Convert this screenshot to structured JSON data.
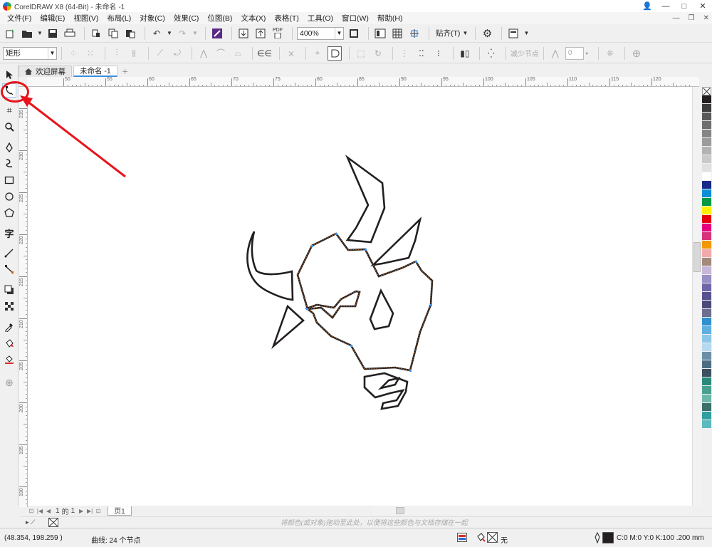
{
  "window": {
    "title": "CorelDRAW X8 (64-Bit) - 未命名 -1",
    "controls": [
      "minimize",
      "maximize",
      "close"
    ]
  },
  "menu": [
    "文件(F)",
    "编辑(E)",
    "视图(V)",
    "布局(L)",
    "对象(C)",
    "效果(C)",
    "位图(B)",
    "文本(X)",
    "表格(T)",
    "工具(O)",
    "窗口(W)",
    "帮助(H)"
  ],
  "toolbar": {
    "zoom_value": "400%",
    "snap_label": "贴齐(T)",
    "pdf_label": "PDF"
  },
  "property_bar": {
    "object_type": "矩形",
    "reduce_nodes_label": "减少节点",
    "smoothness_value": "0"
  },
  "tabs": [
    {
      "label": "欢迎屏幕",
      "active": false
    },
    {
      "label": "未命名 -1",
      "active": true
    }
  ],
  "rulers": {
    "horizontal_labels": [
      "50",
      "55",
      "60",
      "65",
      "70",
      "75",
      "80",
      "85",
      "90",
      "95",
      "100",
      "105",
      "110",
      "115",
      "120"
    ],
    "vertical_labels": [
      "235",
      "230",
      "225",
      "220",
      "215",
      "210",
      "205",
      "200",
      "195",
      "190",
      "185"
    ]
  },
  "page_nav": {
    "current": "1",
    "of_label": "的",
    "total": "1",
    "page_tab": "页1"
  },
  "color_hint": "将颜色(或对象)拖动至此处，以便将这些颜色与文档存储在一起",
  "status": {
    "coordinates": "(48.354, 198.259 )",
    "selection_info": "曲线: 24 个节点",
    "fill_none_label": "无",
    "outline_info": "C:0 M:0 Y:0 K:100  .200 mm"
  },
  "palette_colors": [
    "#231f20",
    "#3d3d3d",
    "#585858",
    "#6f6f6f",
    "#858585",
    "#9c9c9c",
    "#b3b3b3",
    "#cacaca",
    "#e1e1e1",
    "#ffffff",
    "#1a2a8a",
    "#0b8fd6",
    "#009944",
    "#fff100",
    "#e60012",
    "#e4007f",
    "#d6337a",
    "#f39800",
    "#f3a9a9",
    "#a38a7a",
    "#c7b6d9",
    "#9a8fc4",
    "#6e66a8",
    "#55528f",
    "#4a4a7a",
    "#6d6d8f",
    "#2f8fd0",
    "#5fb0e0",
    "#8cc7e8",
    "#b5d9ee",
    "#6a90a8",
    "#4c6e84",
    "#3c5060",
    "#2a8a7a",
    "#4aa090",
    "#6cb8a8",
    "#3d6f6a",
    "#2f9fa0",
    "#5bbac0"
  ]
}
